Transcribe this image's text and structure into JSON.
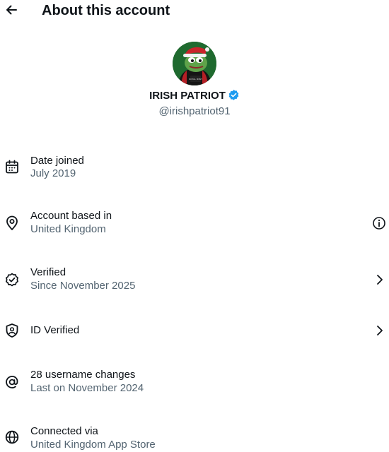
{
  "header": {
    "title": "About this account",
    "back_icon": "arrow-left-icon"
  },
  "profile": {
    "display_name": "IRISH PATRIOT",
    "handle": "@irishpatriot91",
    "verified_badge_color": "#1d9bf0",
    "avatar_text": "ROYAL IRISH"
  },
  "rows": [
    {
      "icon": "calendar-icon",
      "label": "Date joined",
      "value": "July 2019"
    },
    {
      "icon": "location-pin-icon",
      "label": "Account based in",
      "value": "United Kingdom",
      "trailing_icon": "info-icon"
    },
    {
      "icon": "verified-check-icon",
      "label": "Verified",
      "value": "Since November 2025",
      "trailing_icon": "chevron-right-icon"
    },
    {
      "icon": "shield-user-icon",
      "label": "ID Verified",
      "trailing_icon": "chevron-right-icon"
    },
    {
      "icon": "at-sign-icon",
      "label": "28 username changes",
      "value": "Last on November 2024"
    },
    {
      "icon": "globe-icon",
      "label": "Connected via",
      "value": "United Kingdom App Store"
    }
  ]
}
